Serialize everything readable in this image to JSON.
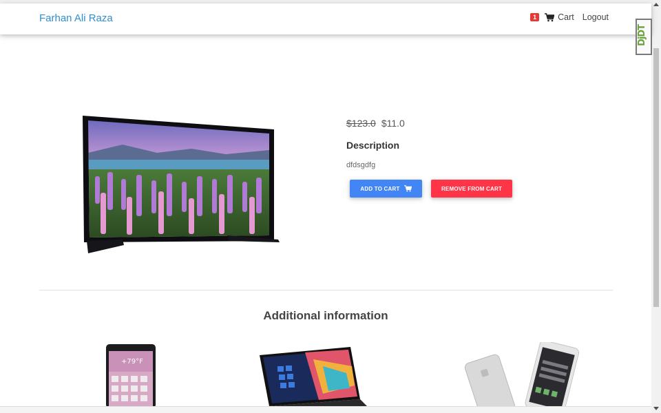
{
  "navbar": {
    "brand": "Farhan Ali Raza",
    "cart_count": "1",
    "cart_label": "Cart",
    "logout_label": "Logout"
  },
  "devtools_badge": "DjDT",
  "product": {
    "old_price": "$123.0",
    "new_price": "$11.0",
    "description_title": "Description",
    "description": "dfdsgdfg",
    "add_to_cart_label": "ADD TO CART",
    "remove_from_cart_label": "REMOVE FROM CART"
  },
  "additional": {
    "title": "Additional information"
  },
  "colors": {
    "brand": "#2e8fd0",
    "add_button": "#4285f4",
    "remove_button": "#ff3547",
    "badge": "#e53935"
  },
  "icons": [
    "cart-icon"
  ]
}
